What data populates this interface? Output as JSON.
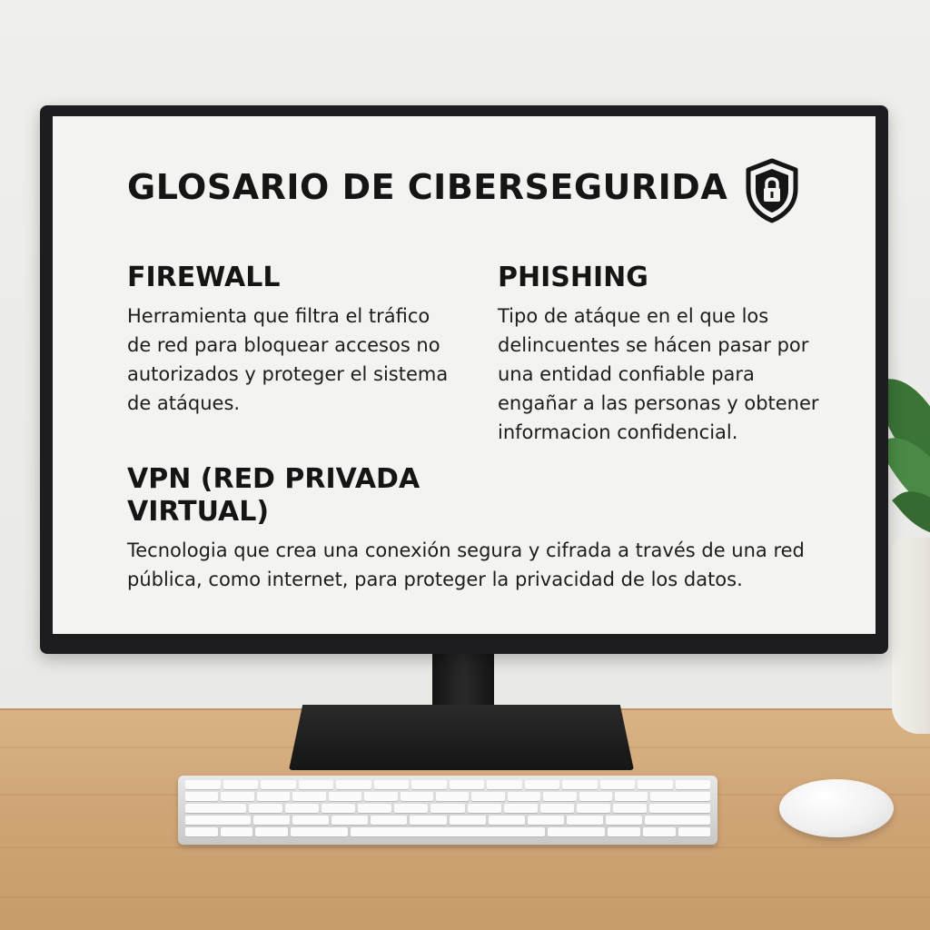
{
  "glossary": {
    "title": "GLOSARIO DE CIBERSEGURIDA",
    "title_icon": "shield-lock-icon",
    "entries": [
      {
        "term": "FIREWALL",
        "definition": "Herramienta que filtra el tráfico de red para bloquear accesos no autorizados y proteger el sistema de atáques."
      },
      {
        "term": "PHISHING",
        "definition": "Tipo de atáque en el que los delincuentes se hácen pasar por una entidad confiable para engañar a las personas y obtener informacion confidencial."
      },
      {
        "term": "VPN (RED PRIVADA VIRTUAL)",
        "definition": "Tecnologia que crea una conexión segura y cifrada a través de una red pública, como internet, para proteger la privacidad de los datos."
      }
    ]
  },
  "colors": {
    "screen_background": "#f3f3f1",
    "text": "#151515",
    "monitor_bezel": "#1d1d1f",
    "desk": "#cfa576",
    "wall": "#ececea"
  }
}
